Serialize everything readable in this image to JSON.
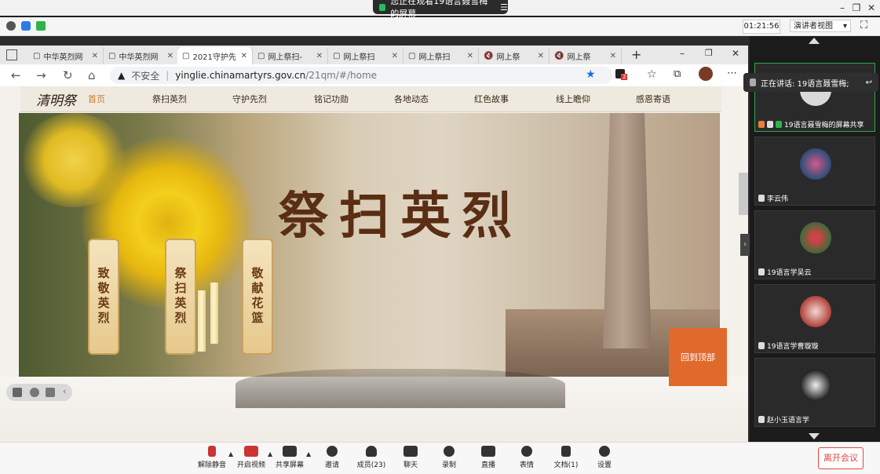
{
  "meeting": {
    "share_status": "您正在观看19语言聂雪梅的屏幕",
    "timer": "01:21:56",
    "view_mode": "演讲者视图",
    "speaking": "正在讲话: 19语言聂雪梅;"
  },
  "browser": {
    "tabs": [
      {
        "label": "中华英烈网"
      },
      {
        "label": "中华英烈网"
      },
      {
        "label": "2021守护先"
      },
      {
        "label": "网上祭扫-"
      },
      {
        "label": "网上祭扫"
      },
      {
        "label": "网上祭扫"
      },
      {
        "label": "网上祭"
      },
      {
        "label": "网上祭"
      }
    ],
    "insecure_label": "不安全",
    "url_host": "yinglie.chinamartyrs.gov.cn",
    "url_path": "/21qm/#/home",
    "badge_count": "2"
  },
  "site": {
    "logo": "清明祭",
    "nav": [
      "首页",
      "祭扫英烈",
      "守护先烈",
      "铭记功勋",
      "各地动态",
      "红色故事",
      "线上瞻仰",
      "感恩寄语"
    ],
    "banner_title": "祭扫英烈",
    "scrolls": [
      "致敬英烈",
      "祭扫英烈",
      "敬献花篮"
    ],
    "back_to_top": "回到顶部"
  },
  "participants": [
    {
      "name": "19语言聂雪梅的屏幕共享"
    },
    {
      "name": "李云伟"
    },
    {
      "name": "19语言学吴云"
    },
    {
      "name": "19语言学曹璇璇"
    },
    {
      "name": "赵小玉语言学"
    }
  ],
  "toolbar": {
    "items": [
      {
        "label": "解除静音"
      },
      {
        "label": "开启视频"
      },
      {
        "label": "共享屏幕"
      },
      {
        "label": "邀请"
      },
      {
        "label": "成员(23)"
      },
      {
        "label": "聊天"
      },
      {
        "label": "录制"
      },
      {
        "label": "直播"
      },
      {
        "label": "表情"
      },
      {
        "label": "文档(1)"
      },
      {
        "label": "设置"
      }
    ],
    "leave_label": "离开会议"
  }
}
